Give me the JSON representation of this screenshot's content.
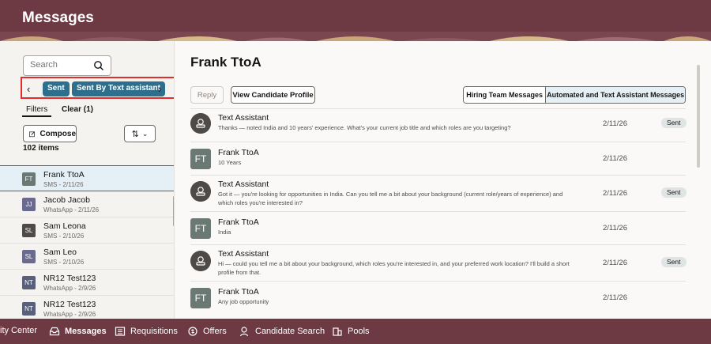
{
  "header": {
    "title": "Messages"
  },
  "search": {
    "placeholder": "Search"
  },
  "filter_chips": {
    "sent": "Sent",
    "sent_by": "Sent By Text assistant"
  },
  "filters": {
    "label": "Filters",
    "clear_label": "Clear (1)"
  },
  "toolbar": {
    "compose_label": "Compose",
    "item_count": "102 items"
  },
  "conversations": [
    {
      "initials": "FT",
      "name": "Frank TtoA",
      "sub": "SMS - 2/11/26",
      "color": "#6b7974"
    },
    {
      "initials": "JJ",
      "name": "Jacob Jacob",
      "sub": "WhatsApp - 2/11/26",
      "color": "#6a6a8f"
    },
    {
      "initials": "SL",
      "name": "Sam Leona",
      "sub": "SMS - 2/10/26",
      "color": "#4e4a47"
    },
    {
      "initials": "SL",
      "name": "Sam Leo",
      "sub": "SMS - 2/10/26",
      "color": "#6a6a8f"
    },
    {
      "initials": "NT",
      "name": "NR12 Test123",
      "sub": "WhatsApp - 2/9/26",
      "color": "#5a5f7a"
    },
    {
      "initials": "NT",
      "name": "NR12 Test123",
      "sub": "WhatsApp - 2/9/26",
      "color": "#5a5f7a"
    }
  ],
  "main": {
    "title": "Frank TtoA",
    "reply_label": "Reply",
    "profile_label": "View Candidate Profile",
    "tabs": [
      "Hiring Team Messages",
      "Automated and Text Assistant Messages"
    ]
  },
  "messages": [
    {
      "sender": "Text Assistant",
      "body": "Thanks — noted India and 10 years' experience. What's your current job title and which roles are you targeting?",
      "date": "2/11/26",
      "status": "Sent",
      "avatar": "assistant"
    },
    {
      "sender": "Frank TtoA",
      "body": "10 Years",
      "date": "2/11/26",
      "status": "",
      "avatar": "FT"
    },
    {
      "sender": "Text Assistant",
      "body": "Got it — you're looking for opportunities in India. Can you tell me a bit about your background (current role/years of experience) and which roles you're interested in?",
      "date": "2/11/26",
      "status": "Sent",
      "avatar": "assistant"
    },
    {
      "sender": "Frank TtoA",
      "body": "India",
      "date": "2/11/26",
      "status": "",
      "avatar": "FT"
    },
    {
      "sender": "Text Assistant",
      "body": "Hi — could you tell me a bit about your background, which roles you're interested in, and your preferred work location? I'll build a short profile from that.",
      "date": "2/11/26",
      "status": "Sent",
      "avatar": "assistant"
    },
    {
      "sender": "Frank TtoA",
      "body": "Any job opportunity",
      "date": "2/11/26",
      "status": "",
      "avatar": "FT"
    }
  ],
  "nav": [
    "ity Center",
    "Messages",
    "Requisitions",
    "Offers",
    "Candidate Search",
    "Pools"
  ],
  "colors": {
    "brand": "#6d3a43",
    "accent": "#2e6f8e",
    "highlight": "#e02d2d"
  },
  "icons": [
    "search-icon",
    "chevron-left-icon",
    "chevron-right-icon",
    "compose-icon",
    "sort-icon",
    "assistant-icon"
  ]
}
